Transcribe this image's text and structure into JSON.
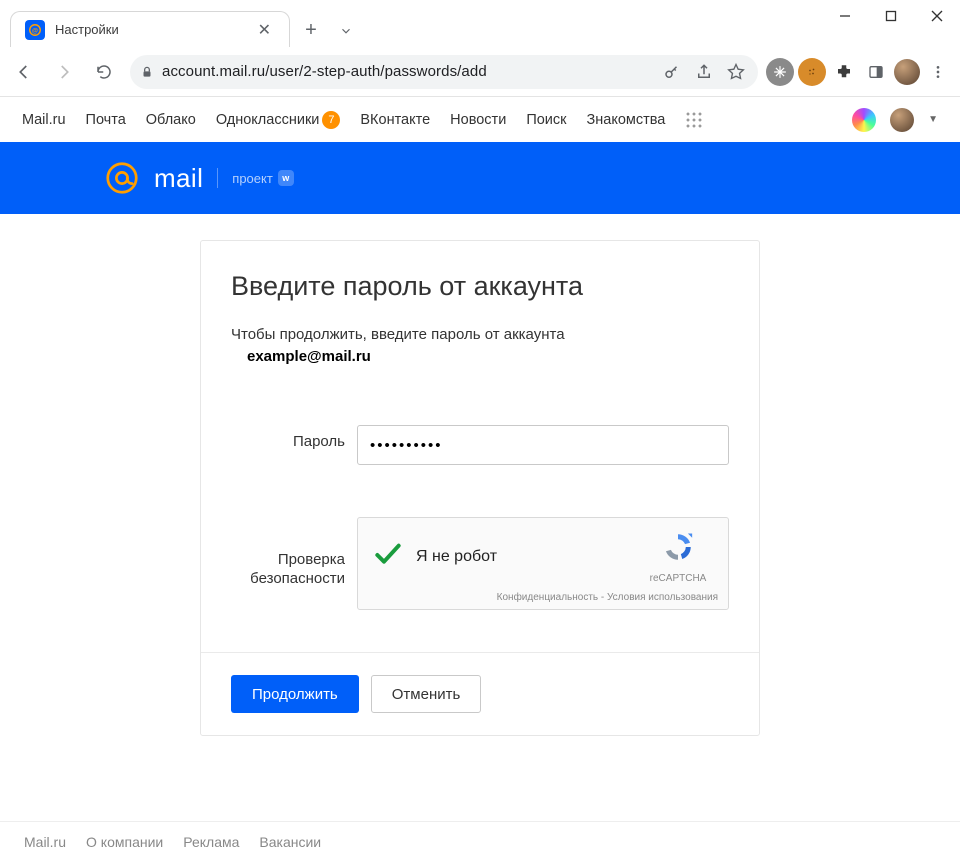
{
  "browser": {
    "tab_title": "Настройки",
    "url": "account.mail.ru/user/2-step-auth/passwords/add"
  },
  "topnav": {
    "links": [
      "Mail.ru",
      "Почта",
      "Облако",
      "Одноклассники",
      "ВКонтакте",
      "Новости",
      "Поиск",
      "Знакомства"
    ],
    "odnoklassniki_badge": "7"
  },
  "header": {
    "brand": "mail",
    "sub": "проект"
  },
  "form": {
    "title": "Введите пароль от аккаунта",
    "hint": "Чтобы продолжить, введите пароль от аккаунта",
    "email": "example@mail.ru",
    "password_label": "Пароль",
    "password_value": "••••••••••",
    "security_label_line1": "Проверка",
    "security_label_line2": "безопасности",
    "captcha_label": "Я не робот",
    "recaptcha_name": "reCAPTCHA",
    "captcha_privacy": "Конфиденциальность",
    "captcha_terms": "Условия использования",
    "submit": "Продолжить",
    "cancel": "Отменить"
  },
  "footer": {
    "links": [
      "Mail.ru",
      "О компании",
      "Реклама",
      "Вакансии"
    ]
  }
}
